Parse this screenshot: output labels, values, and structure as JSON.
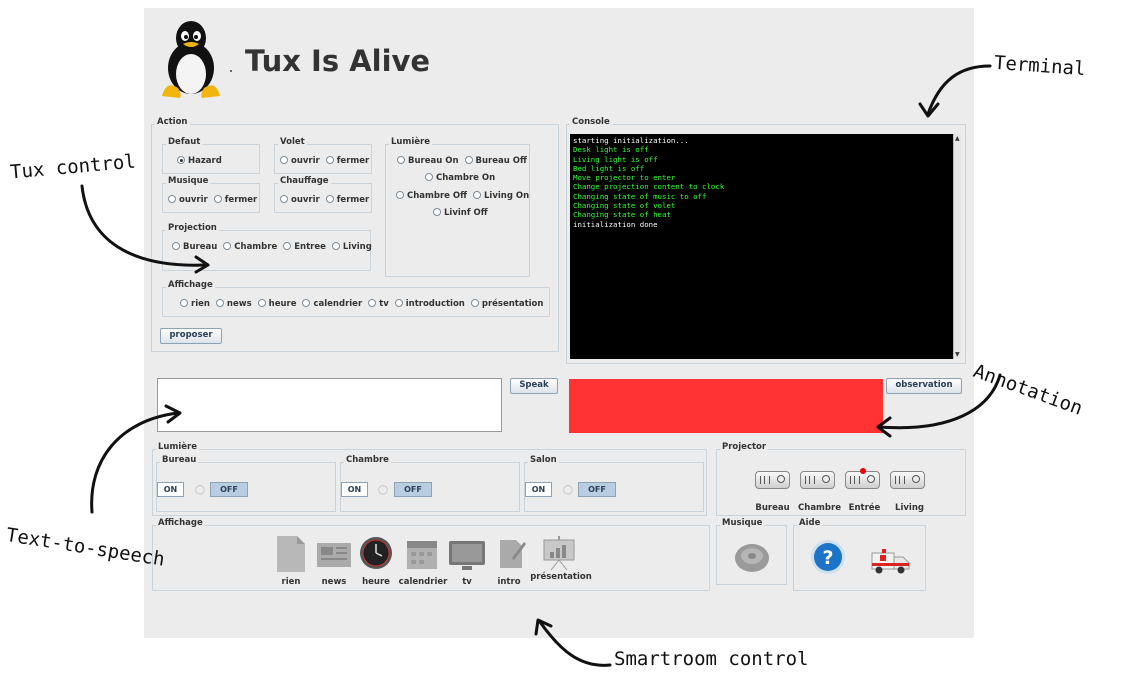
{
  "window": {
    "title": "Tux Is Alive"
  },
  "action": {
    "legend": "Action",
    "defaut": {
      "legend": "Defaut",
      "options": [
        "Hazard"
      ]
    },
    "volet": {
      "legend": "Volet",
      "options": [
        "ouvrir",
        "fermer"
      ]
    },
    "lumiere": {
      "legend": "Lumière",
      "options": [
        "Bureau On",
        "Bureau Off",
        "Chambre On",
        "Chambre Off",
        "Living On",
        "Livinf Off"
      ]
    },
    "musique": {
      "legend": "Musique",
      "options": [
        "ouvrir",
        "fermer"
      ]
    },
    "chauffage": {
      "legend": "Chauffage",
      "options": [
        "ouvrir",
        "fermer"
      ]
    },
    "projection": {
      "legend": "Projection",
      "options": [
        "Bureau",
        "Chambre",
        "Entree",
        "Living"
      ]
    },
    "affichage": {
      "legend": "Affichage",
      "options": [
        "rien",
        "news",
        "heure",
        "calendrier",
        "tv",
        "introduction",
        "présentation"
      ]
    },
    "proposer_label": "proposer"
  },
  "console": {
    "legend": "Console",
    "lines": [
      {
        "text": "starting initialization...",
        "color": "#ffffff"
      },
      {
        "text": "Desk light is off",
        "color": "#33ff33"
      },
      {
        "text": "Living light is off",
        "color": "#33ff33"
      },
      {
        "text": "Bed light is off",
        "color": "#33ff33"
      },
      {
        "text": "Move projector to enter",
        "color": "#33ff33"
      },
      {
        "text": "Change projection content to clock",
        "color": "#33ff33"
      },
      {
        "text": "Changing state of music to off",
        "color": "#33ff33"
      },
      {
        "text": "Changing state of volet",
        "color": "#33ff33"
      },
      {
        "text": "Changing state of heat",
        "color": "#33ff33"
      },
      {
        "text": "initialization done",
        "color": "#ffffff"
      }
    ]
  },
  "speech": {
    "input_value": "",
    "button_label": "Speak"
  },
  "observation": {
    "button_label": "observation",
    "indicator_color": "#ff3333"
  },
  "lumiere_panel": {
    "legend": "Lumière",
    "rooms": [
      {
        "name": "Bureau",
        "on": "ON",
        "off": "OFF"
      },
      {
        "name": "Chambre",
        "on": "ON",
        "off": "OFF"
      },
      {
        "name": "Salon",
        "on": "ON",
        "off": "OFF"
      }
    ]
  },
  "projector": {
    "legend": "Projector",
    "items": [
      "Bureau",
      "Chambre",
      "Entrée",
      "Living"
    ],
    "active_item": "Entrée"
  },
  "affichage_panel": {
    "legend": "Affichage",
    "items": [
      {
        "label": "rien",
        "icon": "blank-page-icon"
      },
      {
        "label": "news",
        "icon": "newspaper-icon"
      },
      {
        "label": "heure",
        "icon": "clock-icon"
      },
      {
        "label": "calendrier",
        "icon": "calendar-icon"
      },
      {
        "label": "tv",
        "icon": "tv-icon"
      },
      {
        "label": "intro",
        "icon": "document-pen-icon"
      },
      {
        "label": "présentation",
        "icon": "presentation-board-icon"
      }
    ]
  },
  "musique_panel": {
    "legend": "Musique",
    "icon": "speaker-icon"
  },
  "aide_panel": {
    "legend": "Aide",
    "icons": [
      "help-icon",
      "ambulance-icon"
    ]
  },
  "annotations": {
    "terminal": "Terminal",
    "tux_control": "Tux control",
    "annotation": "Annotation",
    "text_to_speech": "Text-to-speech",
    "smartroom_control": "Smartroom control"
  }
}
